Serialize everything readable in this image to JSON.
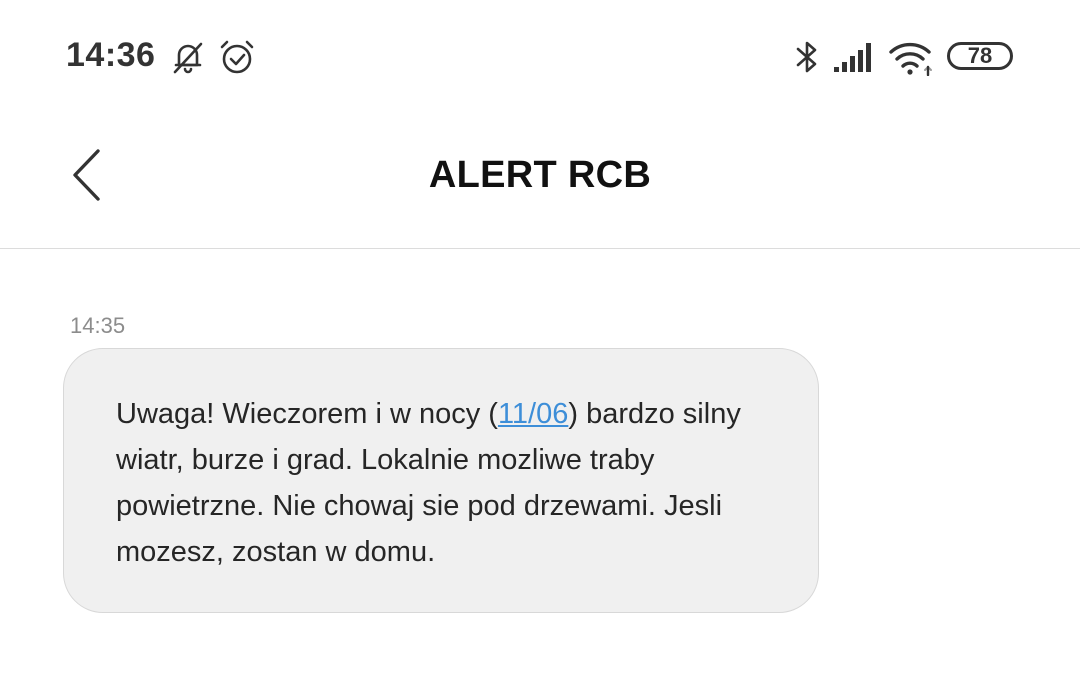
{
  "status_bar": {
    "time": "14:36",
    "battery_level": "78",
    "icons": [
      "bell-off-icon",
      "alarm-icon",
      "bluetooth-icon",
      "signal-icon",
      "wifi-icon",
      "battery-icon"
    ]
  },
  "header": {
    "title": "ALERT RCB",
    "back_icon": "chevron-left-icon"
  },
  "message": {
    "timestamp": "14:35",
    "text_before_link": "Uwaga! Wieczorem i w nocy (",
    "link_text": "11/06",
    "text_after_link": ") bardzo silny wiatr, burze i grad. Lokalnie mozliwe traby powietrzne. Nie chowaj sie pod drzewami. Jesli mozesz, zostan w domu.",
    "bubble_color": "#f0f0f0",
    "link_color": "#3d8ed8"
  }
}
